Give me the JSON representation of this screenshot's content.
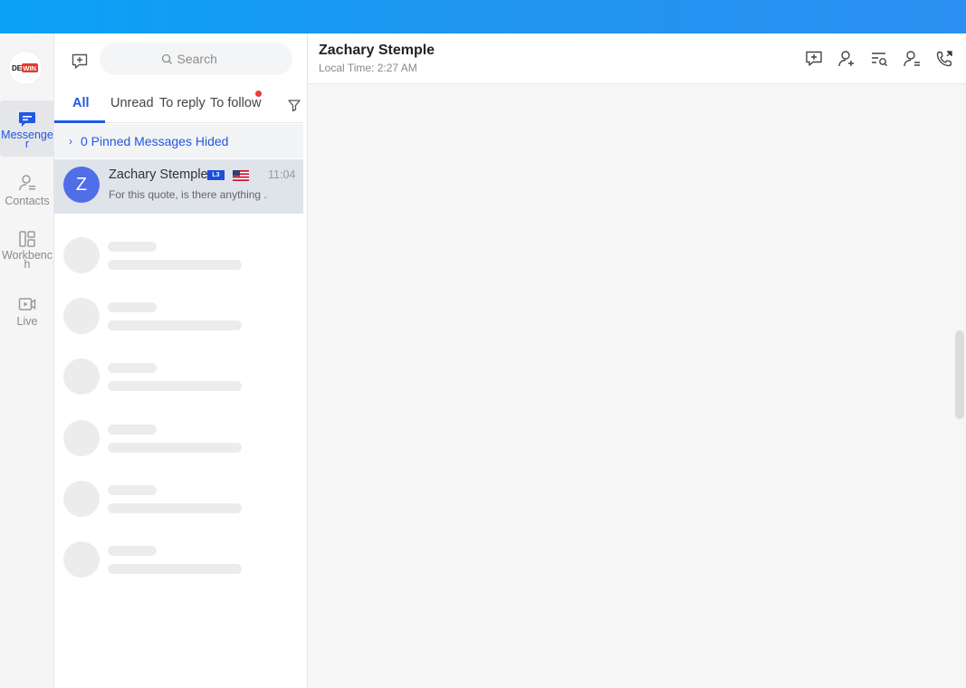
{
  "app": {
    "logo_text": "DEWIN"
  },
  "rail": {
    "items": [
      {
        "label": "Messenger",
        "icon": "message-icon",
        "active": true
      },
      {
        "label": "Contacts",
        "icon": "contacts-icon",
        "active": false
      },
      {
        "label": "Workbench",
        "icon": "workbench-icon",
        "active": false
      },
      {
        "label": "Live",
        "icon": "live-video-icon",
        "active": false
      }
    ]
  },
  "search": {
    "placeholder": "Search"
  },
  "tabs": [
    {
      "label": "All",
      "active": true
    },
    {
      "label": "Unread",
      "active": false
    },
    {
      "label": "To reply",
      "active": false
    },
    {
      "label": "To follow",
      "active": false,
      "has_dot": true
    }
  ],
  "pinned": {
    "label": "0 Pinned Messages Hided"
  },
  "conversations": [
    {
      "initial": "Z",
      "name": "Zachary Stemple",
      "level_badge": "L3",
      "country_flag": "us-flag-icon",
      "time": "11:04",
      "preview": "For this quote, is there anything ..."
    }
  ],
  "chat": {
    "title": "Zachary Stemple",
    "subtitle": "Local Time: 2:27 AM",
    "header_icons": [
      "add-comment-icon",
      "add-user-icon",
      "search-messages-icon",
      "user-settings-icon",
      "call-icon"
    ]
  },
  "colors": {
    "accent": "#2256e6",
    "topbar": "#0aa2f7",
    "avatar": "#4f6ee8",
    "unread_dot": "#ee3b3b"
  }
}
